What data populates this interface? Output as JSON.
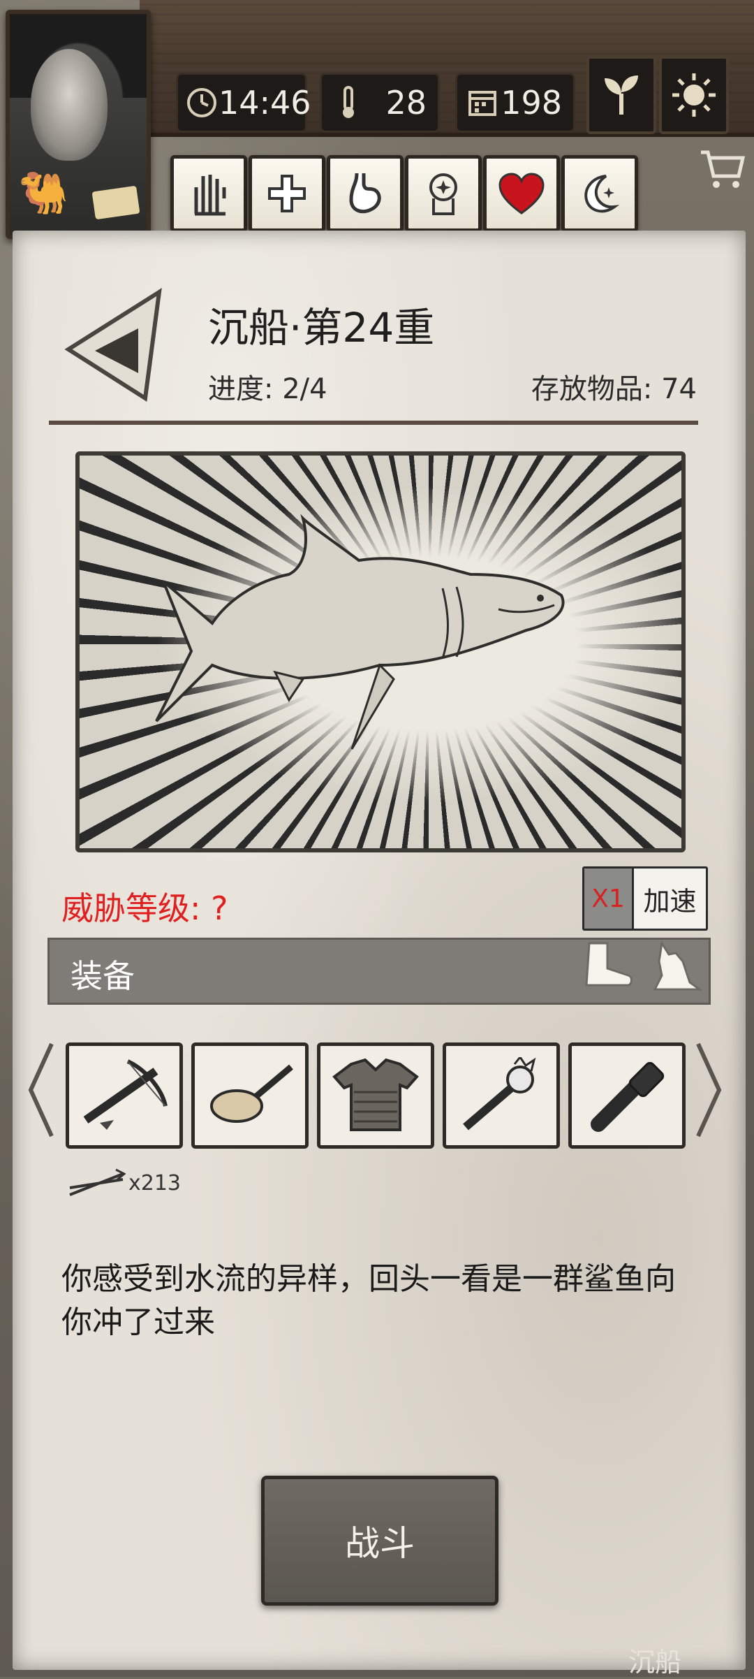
{
  "header": {
    "time": "14:46",
    "temperature": "28",
    "day": "198",
    "icons": {
      "time": "clock-icon",
      "temperature": "thermometer-icon",
      "day": "calendar-icon",
      "plant": "sprout-icon",
      "weather": "sun-icon",
      "shop": "cart-icon"
    },
    "status_icons": [
      "hand-icon",
      "health-cross-icon",
      "stomach-icon",
      "mind-icon",
      "heart-icon",
      "moon-icon"
    ]
  },
  "event": {
    "title": "沉船·第24重",
    "progress": "进度: 2/4",
    "storage": "存放物品: 74",
    "threat": "威胁等级: ?",
    "speed_multiplier": "X1",
    "speed_label": "加速",
    "description": "你感受到水流的异样，回头一看是一群鲨鱼向你冲了过来",
    "fight_label": "战斗",
    "footer": "沉船"
  },
  "equipment": {
    "label": "装备",
    "items": [
      "crossbow",
      "frying-pan",
      "chain-armor",
      "torch",
      "flashlight"
    ],
    "ammo_count": "x213"
  },
  "colors": {
    "threat": "#e02020",
    "paper": "#e6e1d8",
    "plank": "#4a3b2f"
  }
}
